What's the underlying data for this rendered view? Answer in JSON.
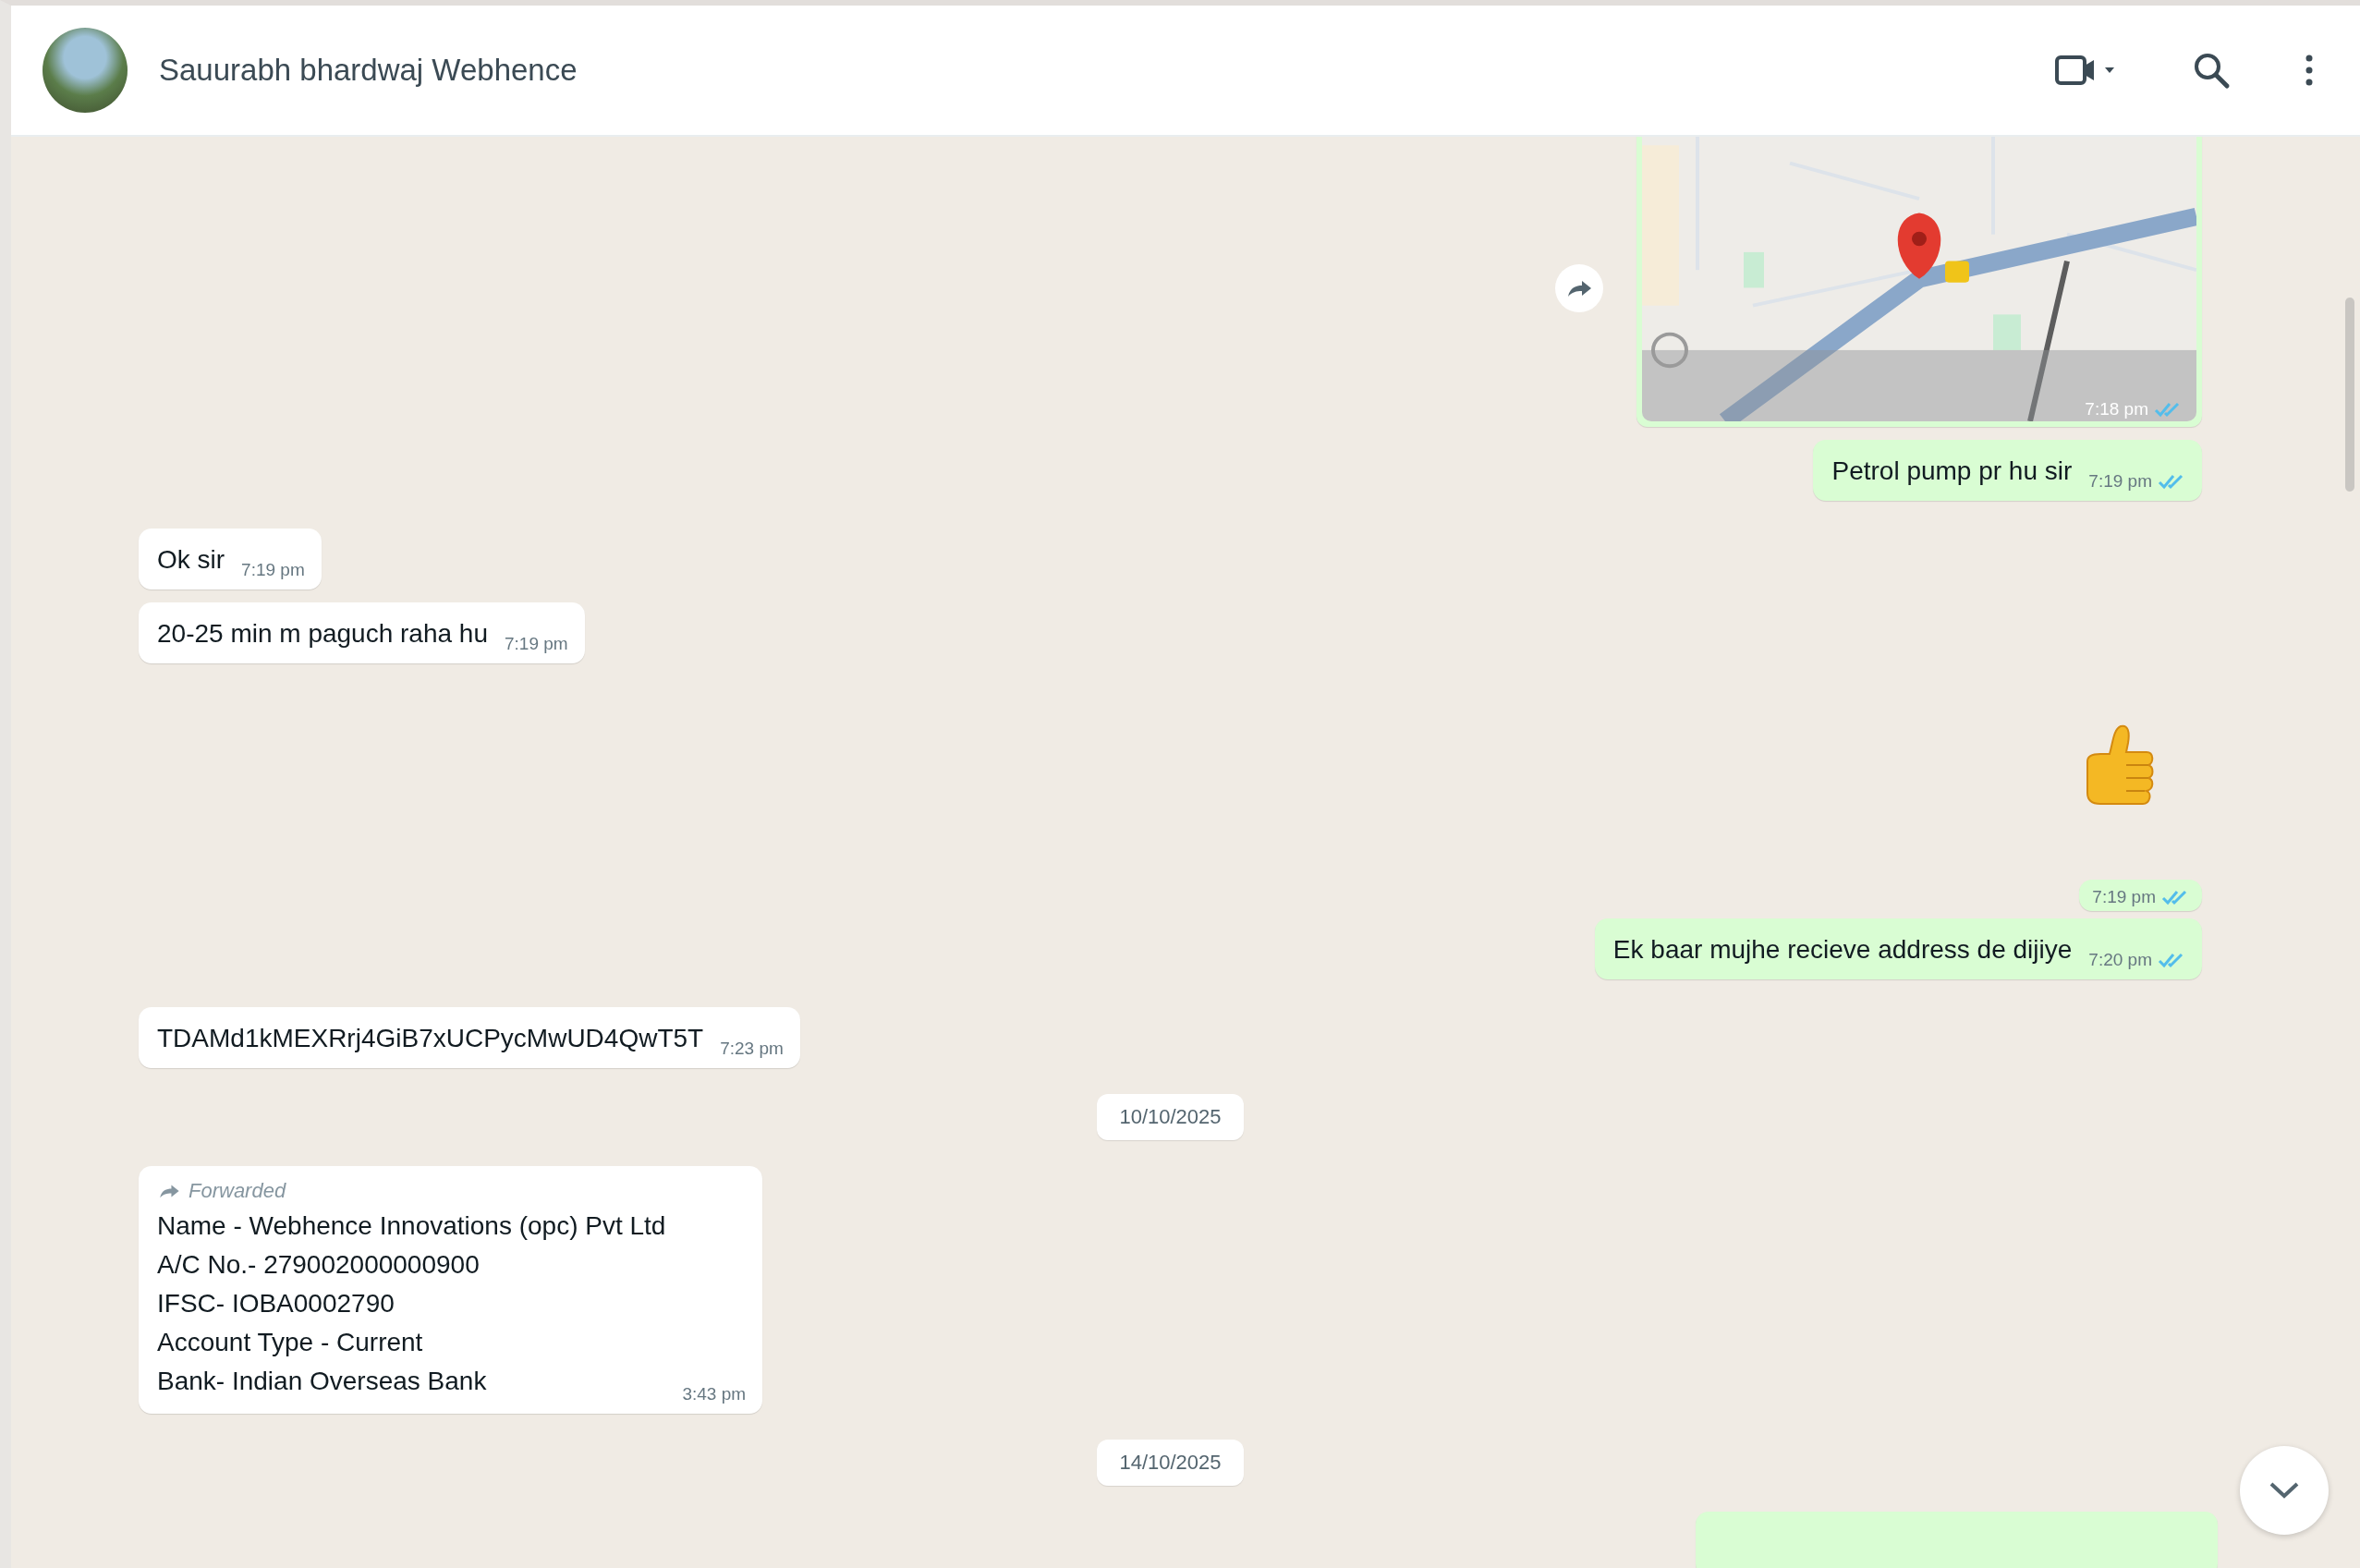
{
  "header": {
    "contact_name": "Sauurabh bhardwaj Webhence"
  },
  "messages": [
    {
      "kind": "location",
      "outgoing": true,
      "time": "7:18 pm",
      "read": true
    },
    {
      "kind": "text",
      "outgoing": true,
      "text": "Petrol pump pr hu sir",
      "time": "7:19 pm",
      "read": true
    },
    {
      "kind": "text",
      "outgoing": false,
      "text": "Ok sir",
      "time": "7:19 pm"
    },
    {
      "kind": "text",
      "outgoing": false,
      "text": "20-25 min m paguch raha hu",
      "time": "7:19 pm"
    },
    {
      "kind": "thumbs_up",
      "outgoing": true,
      "time": "7:19 pm",
      "read": true
    },
    {
      "kind": "text",
      "outgoing": true,
      "text": "Ek baar mujhe recieve address de dijiye",
      "time": "7:20 pm",
      "read": true
    },
    {
      "kind": "text",
      "outgoing": false,
      "text": "TDAMd1kMEXRrj4GiB7xUCPycMwUD4QwT5T",
      "time": "7:23 pm"
    },
    {
      "kind": "date",
      "text": "10/10/2025"
    },
    {
      "kind": "forwarded",
      "outgoing": false,
      "label": "Forwarded",
      "text": "Name - Webhence Innovations (opc) Pvt Ltd\nA/C No.- 279002000000900\nIFSC- IOBA0002790\nAccount Type - Current\nBank- Indian Overseas Bank",
      "time": "3:43 pm"
    },
    {
      "kind": "date",
      "text": "14/10/2025"
    },
    {
      "kind": "partial",
      "outgoing": true
    }
  ]
}
